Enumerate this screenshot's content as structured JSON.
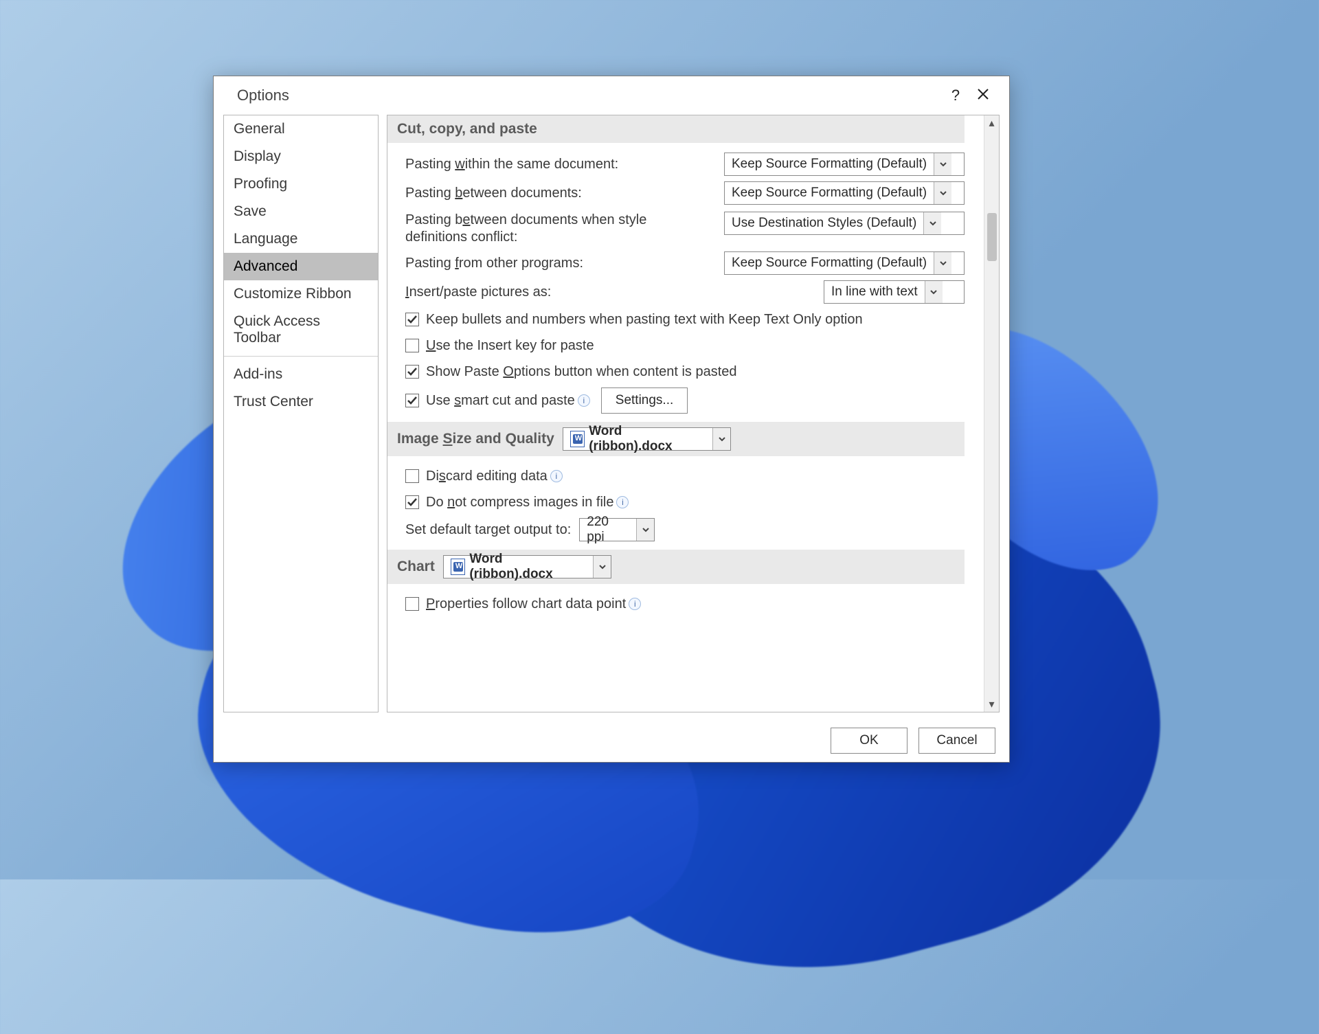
{
  "title": "Options",
  "nav": [
    "General",
    "Display",
    "Proofing",
    "Save",
    "Language",
    "Advanced",
    "Customize Ribbon",
    "Quick Access Toolbar",
    "Add-ins",
    "Trust Center"
  ],
  "navSelectedIndex": 5,
  "sections": {
    "cutcopy": {
      "title": "Cut, copy, and paste",
      "labels": {
        "within": {
          "pre": "Pasting ",
          "u": "w",
          "post": "ithin the same document:"
        },
        "between": {
          "pre": "Pasting ",
          "u": "b",
          "post": "etween documents:"
        },
        "conflict": {
          "pre": "Pasting b",
          "u": "e",
          "post": "tween documents when style definitions conflict:"
        },
        "programs": {
          "pre": "Pasting ",
          "u": "f",
          "post": "rom other programs:"
        },
        "pictures": {
          "pre": "",
          "u": "I",
          "post": "nsert/paste pictures as:"
        }
      },
      "dropdowns": {
        "within": "Keep Source Formatting (Default)",
        "between": "Keep Source Formatting (Default)",
        "conflict": "Use Destination Styles (Default)",
        "programs": "Keep Source Formatting (Default)",
        "pictures": "In line with text"
      },
      "checks": {
        "bullets": {
          "checked": true,
          "text": "Keep bullets and numbers when pasting text with Keep Text Only option"
        },
        "insertkey": {
          "checked": false,
          "pre": "",
          "u": "U",
          "post": "se the Insert key for paste"
        },
        "pasteopt": {
          "checked": true,
          "pre": "Show Paste ",
          "u": "O",
          "post": "ptions button when content is pasted"
        },
        "smartcut": {
          "checked": true,
          "pre": "Use ",
          "u": "s",
          "post": "mart cut and paste"
        }
      },
      "settingsBtn": "Settings..."
    },
    "image": {
      "title": {
        "pre": "Image ",
        "u": "S",
        "post": "ize and Quality"
      },
      "file": "Word (ribbon).docx",
      "discard": {
        "checked": false,
        "pre": "Di",
        "u": "s",
        "post": "card editing data"
      },
      "nocompress": {
        "checked": true,
        "pre": "Do ",
        "u": "n",
        "post": "ot compress images in file"
      },
      "target": {
        "label": "Set default target output to:",
        "value": "220 ppi"
      }
    },
    "chart": {
      "title": "Chart",
      "file": "Word (ribbon).docx",
      "props": {
        "checked": false,
        "pre": "",
        "u": "P",
        "post": "roperties follow chart data point"
      }
    }
  },
  "footer": {
    "ok": "OK",
    "cancel": "Cancel"
  }
}
